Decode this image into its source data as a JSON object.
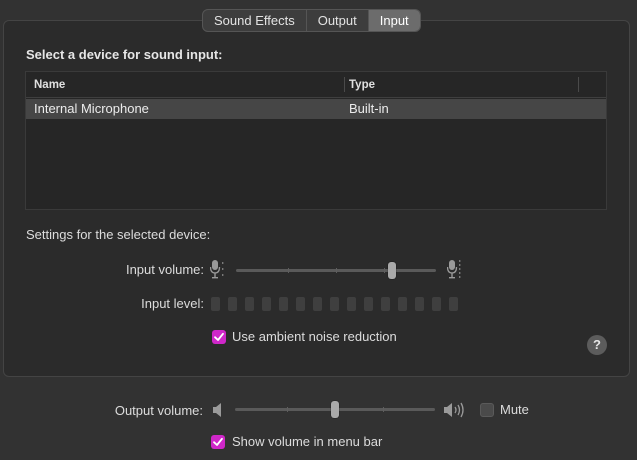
{
  "tabs": [
    {
      "label": "Sound Effects",
      "active": false
    },
    {
      "label": "Output",
      "active": false
    },
    {
      "label": "Input",
      "active": true
    }
  ],
  "input": {
    "heading": "Select a device for sound input:",
    "table": {
      "columns": [
        "Name",
        "Type"
      ],
      "rows": [
        {
          "name": "Internal Microphone",
          "type": "Built-in",
          "selected": true
        }
      ]
    },
    "settings_heading": "Settings for the selected device:",
    "input_volume_label": "Input volume:",
    "input_volume_level": 0.78,
    "input_level_label": "Input level:",
    "input_level_segments": 15,
    "noise_reduction_label": "Use ambient noise reduction",
    "noise_reduction_checked": true,
    "help_label": "?"
  },
  "output": {
    "volume_label": "Output volume:",
    "volume_level": 0.5,
    "mute_label": "Mute",
    "mute_checked": false,
    "show_in_menubar_label": "Show volume in menu bar",
    "show_in_menubar_checked": true
  },
  "colors": {
    "accent": "#cf27c9",
    "background": "#323232",
    "panel": "#2b2b2b"
  },
  "icons": {
    "mic_low": "microphone-low-icon",
    "mic_high": "microphone-high-icon",
    "speaker_low": "speaker-low-icon",
    "speaker_high": "speaker-high-icon",
    "checkmark": "checkmark-icon",
    "help": "help-icon"
  }
}
